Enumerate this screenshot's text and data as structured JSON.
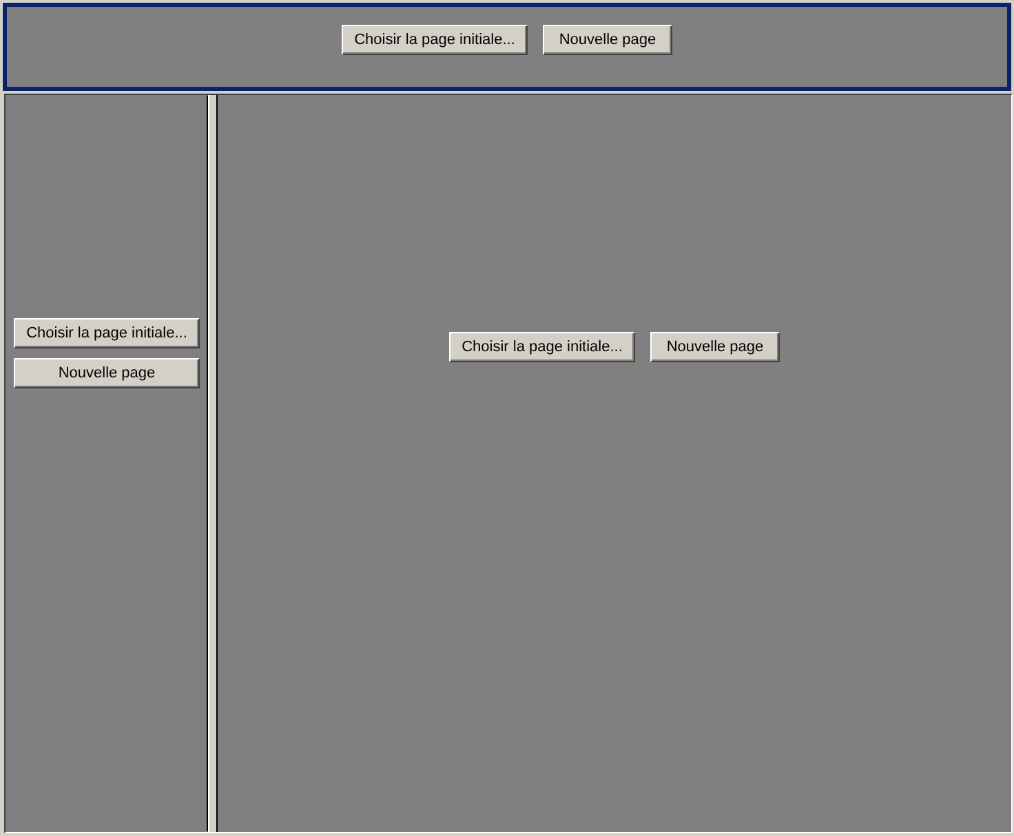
{
  "top_frame": {
    "selected": true,
    "buttons": [
      {
        "label": "Choisir la page initiale..."
      },
      {
        "label": "Nouvelle page"
      }
    ]
  },
  "left_frame": {
    "selected": false,
    "buttons": [
      {
        "label": "Choisir la page initiale..."
      },
      {
        "label": "Nouvelle page"
      }
    ]
  },
  "right_frame": {
    "selected": false,
    "buttons": [
      {
        "label": "Choisir la page initiale..."
      },
      {
        "label": "Nouvelle page"
      }
    ]
  }
}
